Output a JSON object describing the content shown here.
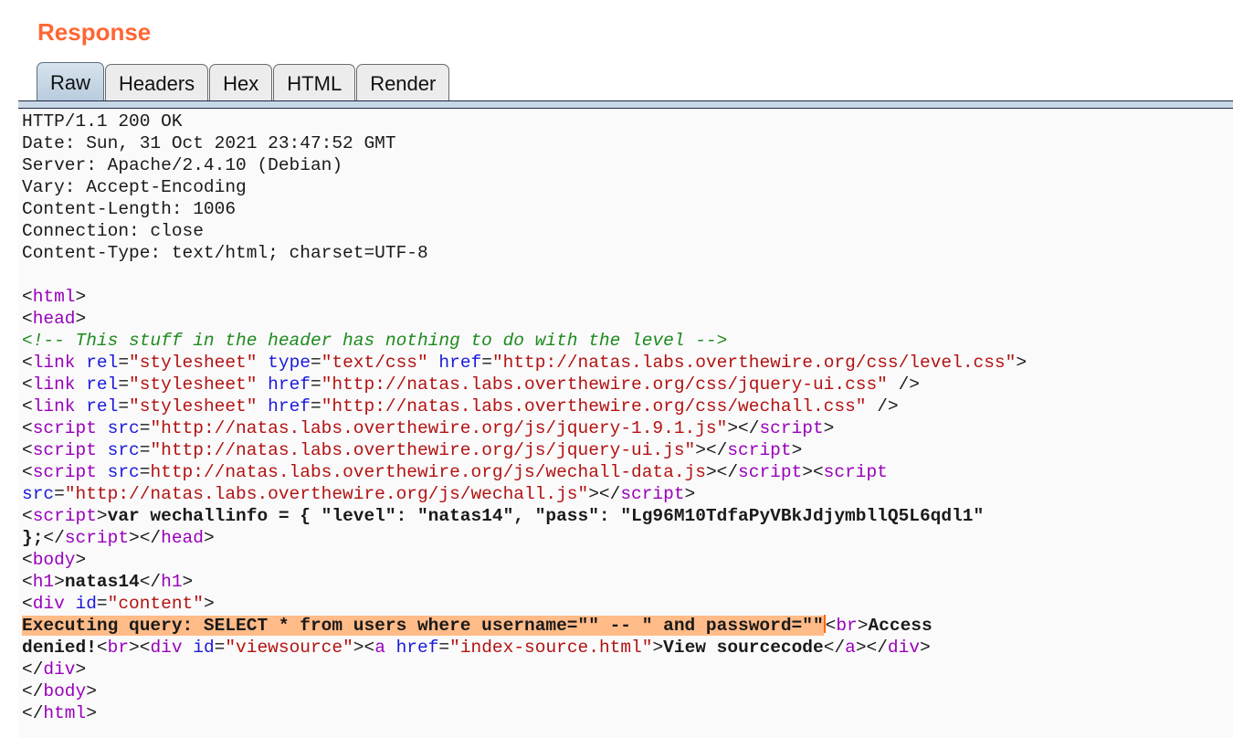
{
  "title": "Response",
  "tabs": [
    "Raw",
    "Headers",
    "Hex",
    "HTML",
    "Render"
  ],
  "active_tab": "Raw",
  "response": {
    "status_line": "HTTP/1.1 200 OK",
    "headers": [
      "Date: Sun, 31 Oct 2021 23:47:52 GMT",
      "Server: Apache/2.4.10 (Debian)",
      "Vary: Accept-Encoding",
      "Content-Length: 1006",
      "Connection: close",
      "Content-Type: text/html; charset=UTF-8"
    ],
    "body": {
      "comment": "<!-- This stuff in the header has nothing to do with the level -->",
      "css_level": "\"http://natas.labs.overthewire.org/css/level.css\"",
      "css_jqueryui": "\"http://natas.labs.overthewire.org/css/jquery-ui.css\"",
      "css_wechall": "\"http://natas.labs.overthewire.org/css/wechall.css\"",
      "js_jquery": "\"http://natas.labs.overthewire.org/js/jquery-1.9.1.js\"",
      "js_jqueryui": "\"http://natas.labs.overthewire.org/js/jquery-ui.js\"",
      "js_wechall_data": "http://natas.labs.overthewire.org/js/wechall-data.js",
      "js_wechall": "\"http://natas.labs.overthewire.org/js/wechall.js\"",
      "wechallinfo_line1": "var wechallinfo = { \"level\": \"natas14\", \"pass\": \"Lg96M10TdfaPyVBkJdjymbllQ5L6qdl1\"",
      "wechallinfo_line2": "};",
      "h1_text": "natas14",
      "div_id": "\"content\"",
      "query": "Executing query: SELECT * from users where username=\"\" -- \" and password=\"\"",
      "access": "Access",
      "denied": "denied!",
      "viewsource_id": "\"viewsource\"",
      "viewsource_href": "\"index-source.html\"",
      "viewsource_text": "View sourcecode"
    }
  }
}
